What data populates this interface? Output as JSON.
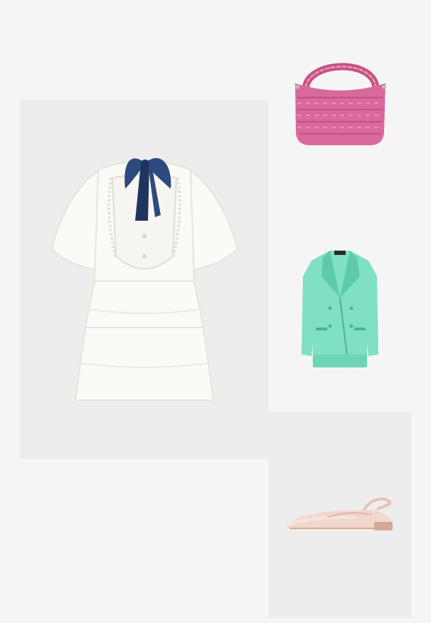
{
  "board": {
    "background": "#f5f5f5",
    "panel_color": "#ededed"
  },
  "items": [
    {
      "id": "dress",
      "icon": "white-ruffle-dress-image",
      "colors": {
        "fabric": "#fbfaf7",
        "shade": "#e6e3dc",
        "bow": "#2c4a7e",
        "bow_dark": "#1f3560"
      }
    },
    {
      "id": "bag",
      "icon": "pink-woven-handbag-image",
      "colors": {
        "body": "#d9699c",
        "weave": "#c4527f",
        "light": "#ec8db7"
      }
    },
    {
      "id": "blazer",
      "icon": "mint-double-breasted-blazer-image",
      "colors": {
        "body": "#7fe0c3",
        "shade": "#5fcaa9",
        "dark": "#49b493"
      }
    },
    {
      "id": "shoes",
      "icon": "nude-slingback-flats-image",
      "colors": {
        "body": "#f2d7cd",
        "shade": "#dcb5a6",
        "sole": "#d4a896"
      }
    }
  ]
}
